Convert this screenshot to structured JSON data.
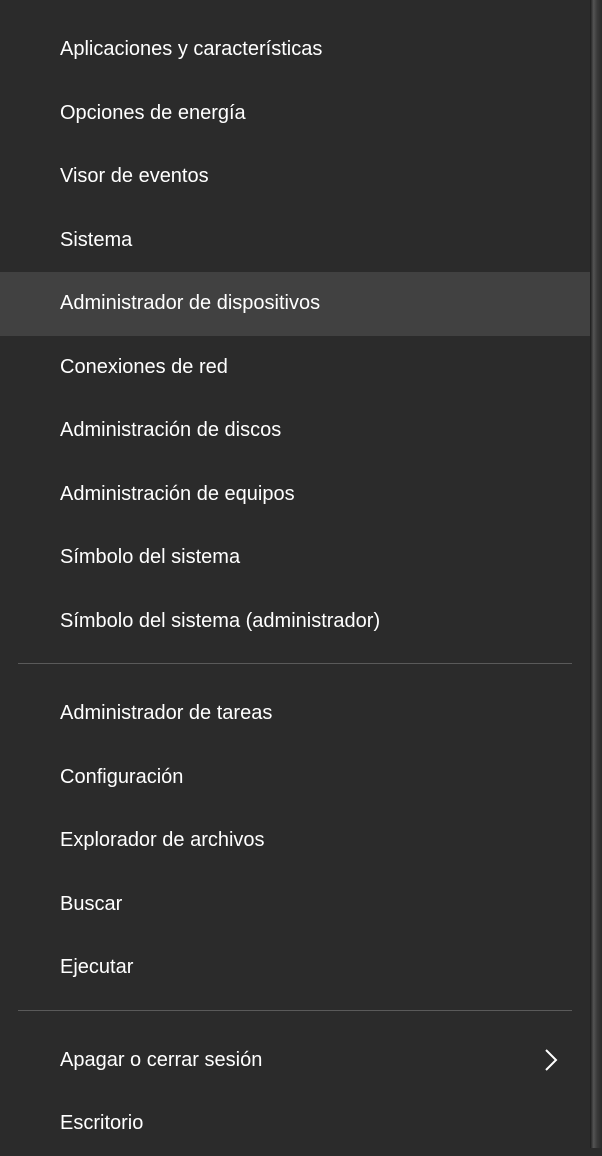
{
  "menu": {
    "groups": [
      {
        "items": [
          {
            "id": "apps-features",
            "label": "Aplicaciones y características",
            "highlighted": false,
            "submenu": false
          },
          {
            "id": "power-options",
            "label": "Opciones de energía",
            "highlighted": false,
            "submenu": false
          },
          {
            "id": "event-viewer",
            "label": "Visor de eventos",
            "highlighted": false,
            "submenu": false
          },
          {
            "id": "system",
            "label": "Sistema",
            "highlighted": false,
            "submenu": false
          },
          {
            "id": "device-manager",
            "label": "Administrador de dispositivos",
            "highlighted": true,
            "submenu": false
          },
          {
            "id": "network-connections",
            "label": "Conexiones de red",
            "highlighted": false,
            "submenu": false
          },
          {
            "id": "disk-management",
            "label": "Administración de discos",
            "highlighted": false,
            "submenu": false
          },
          {
            "id": "computer-management",
            "label": "Administración de equipos",
            "highlighted": false,
            "submenu": false
          },
          {
            "id": "command-prompt",
            "label": "Símbolo del sistema",
            "highlighted": false,
            "submenu": false
          },
          {
            "id": "command-prompt-admin",
            "label": "Símbolo del sistema (administrador)",
            "highlighted": false,
            "submenu": false
          }
        ]
      },
      {
        "items": [
          {
            "id": "task-manager",
            "label": "Administrador de tareas",
            "highlighted": false,
            "submenu": false
          },
          {
            "id": "settings",
            "label": "Configuración",
            "highlighted": false,
            "submenu": false
          },
          {
            "id": "file-explorer",
            "label": "Explorador de archivos",
            "highlighted": false,
            "submenu": false
          },
          {
            "id": "search",
            "label": "Buscar",
            "highlighted": false,
            "submenu": false
          },
          {
            "id": "run",
            "label": "Ejecutar",
            "highlighted": false,
            "submenu": false
          }
        ]
      },
      {
        "items": [
          {
            "id": "shutdown-signout",
            "label": "Apagar o cerrar sesión",
            "highlighted": false,
            "submenu": true
          },
          {
            "id": "desktop",
            "label": "Escritorio",
            "highlighted": false,
            "submenu": false
          }
        ]
      }
    ]
  }
}
